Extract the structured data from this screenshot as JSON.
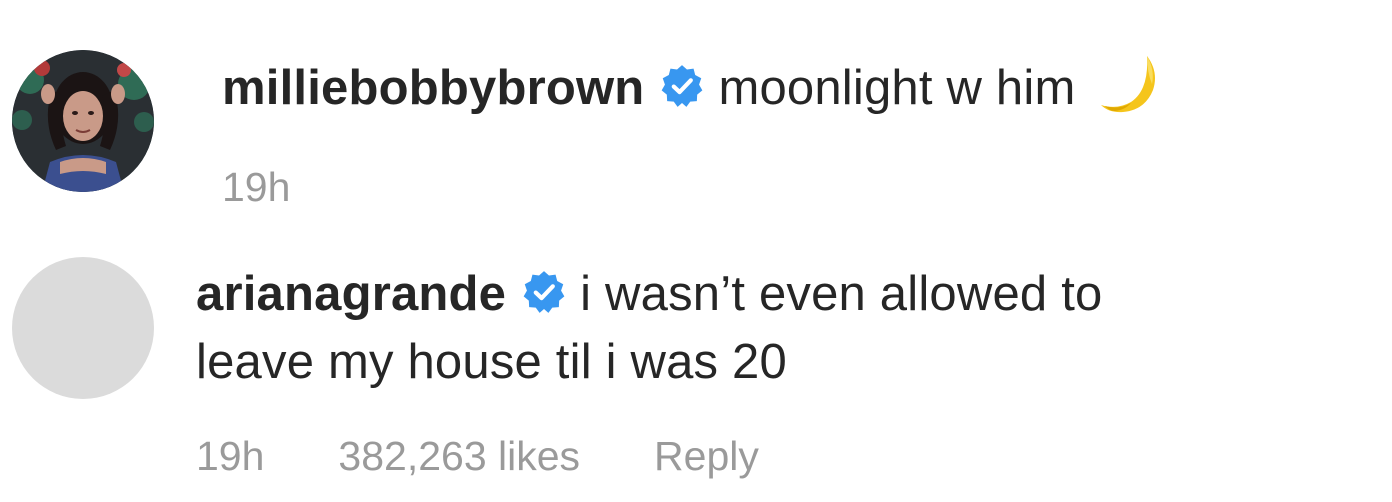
{
  "comments": [
    {
      "username": "milliebobbybrown",
      "verified": true,
      "text": "moonlight w him",
      "emoji": "crescent-moon",
      "time": "19h",
      "avatar": "profile-photo"
    },
    {
      "username": "arianagrande",
      "verified": true,
      "text_line1": "i wasn’t even allowed to",
      "text_line2": "leave my house til i was 20",
      "time": "19h",
      "likes": "382,263 likes",
      "reply_label": "Reply",
      "avatar": "placeholder-grey"
    }
  ],
  "icons": {
    "verified": "verified-badge-icon",
    "emoji": "crescent-moon-icon"
  },
  "colors": {
    "text": "#262626",
    "meta": "#9a9a9a",
    "verified_blue": "#3897f0",
    "avatar_placeholder": "#dbdbdb",
    "moon": "#f5c51c"
  }
}
